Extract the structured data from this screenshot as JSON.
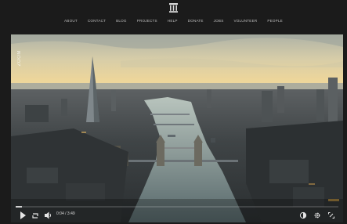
{
  "nav": {
    "items": [
      "ABOUT",
      "CONTACT",
      "BLOG",
      "PROJECTS",
      "HELP",
      "DONATE",
      "JOBS",
      "VOLUNTEER",
      "PEOPLE"
    ]
  },
  "player": {
    "watermark": "ZOOM",
    "time": "0:04 / 3:49",
    "progress": 0.02
  },
  "colors": {
    "page_bg": "#1b1b1b",
    "sky_top": "#c9c3a8",
    "horizon": "#e7cf95",
    "river": "#8ea5a9"
  },
  "icons": {
    "logo": "columns-building-icon",
    "play": "play-icon",
    "loop": "loop-icon",
    "volume": "volume-icon",
    "subtitles": "contrast-icon",
    "settings": "gear-icon",
    "fullscreen": "expand-icon"
  }
}
